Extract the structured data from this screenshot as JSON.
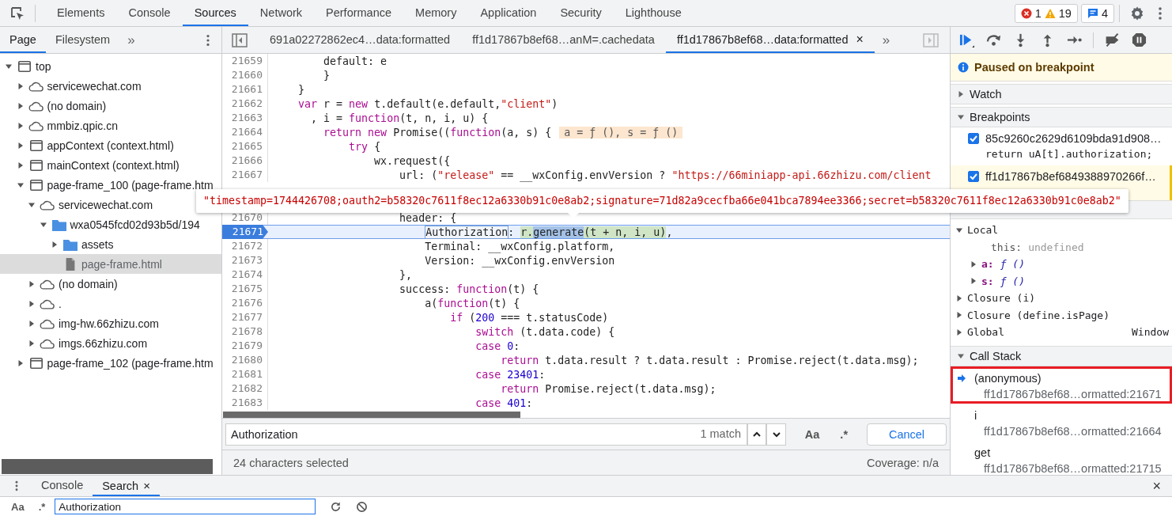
{
  "tabs": [
    {
      "label": "Elements",
      "selected": false
    },
    {
      "label": "Console",
      "selected": false
    },
    {
      "label": "Sources",
      "selected": true
    },
    {
      "label": "Network",
      "selected": false
    },
    {
      "label": "Performance",
      "selected": false
    },
    {
      "label": "Memory",
      "selected": false
    },
    {
      "label": "Application",
      "selected": false
    },
    {
      "label": "Security",
      "selected": false
    },
    {
      "label": "Lighthouse",
      "selected": false
    }
  ],
  "issues": {
    "errors": "1",
    "warnings": "19",
    "messages": "4"
  },
  "navigator": {
    "tabs": [
      {
        "label": "Page",
        "selected": true
      },
      {
        "label": "Filesystem",
        "selected": false
      }
    ],
    "more": "»",
    "tree": [
      {
        "label": "top",
        "kind": "frame",
        "expanded": true,
        "selected": false,
        "children": [
          {
            "label": "servicewechat.com",
            "kind": "domain",
            "expanded": false,
            "selected": false
          },
          {
            "label": "(no domain)",
            "kind": "domain",
            "expanded": false,
            "selected": false
          },
          {
            "label": "mmbiz.qpic.cn",
            "kind": "domain",
            "expanded": false,
            "selected": false
          },
          {
            "label": "appContext (context.html)",
            "kind": "frame",
            "expanded": false,
            "selected": false
          },
          {
            "label": "mainContext (context.html)",
            "kind": "frame",
            "expanded": false,
            "selected": false
          },
          {
            "label": "page-frame_100 (page-frame.htm",
            "kind": "frame",
            "expanded": true,
            "selected": false,
            "children": [
              {
                "label": "servicewechat.com",
                "kind": "domain",
                "expanded": true,
                "selected": false,
                "children": [
                  {
                    "label": "wxa0545fcd02d93b5d/194",
                    "kind": "folder",
                    "expanded": true,
                    "selected": false,
                    "children": [
                      {
                        "label": "assets",
                        "kind": "folder",
                        "expanded": false,
                        "selected": false
                      },
                      {
                        "label": "page-frame.html",
                        "kind": "file",
                        "selected": true
                      }
                    ]
                  }
                ]
              },
              {
                "label": "(no domain)",
                "kind": "domain",
                "expanded": false,
                "selected": false
              },
              {
                "label": ".",
                "kind": "domain",
                "expanded": false,
                "selected": false
              },
              {
                "label": "img-hw.66zhizu.com",
                "kind": "domain",
                "expanded": false,
                "selected": false
              },
              {
                "label": "imgs.66zhizu.com",
                "kind": "domain",
                "expanded": false,
                "selected": false
              }
            ]
          },
          {
            "label": "page-frame_102 (page-frame.htm",
            "kind": "frame",
            "expanded": false,
            "selected": false
          }
        ]
      }
    ]
  },
  "editor": {
    "tabs": [
      {
        "label": "691a02272862ec4…data:formatted",
        "selected": false
      },
      {
        "label": "ff1d17867b8ef68…anM=.cachedata",
        "selected": false
      },
      {
        "label": "ff1d17867b8ef68…data:formatted",
        "selected": true,
        "close": "×"
      }
    ],
    "more": "»",
    "lines": [
      {
        "kind": "code",
        "number": "21659",
        "paused": false,
        "tokens": [
          {
            "text": "        default: e",
            "kind": "plain"
          }
        ]
      },
      {
        "kind": "code",
        "number": "21660",
        "paused": false,
        "tokens": [
          {
            "text": "        }",
            "kind": "plain"
          }
        ]
      },
      {
        "kind": "code",
        "number": "21661",
        "paused": false,
        "tokens": [
          {
            "text": "    }",
            "kind": "plain"
          }
        ]
      },
      {
        "kind": "code",
        "number": "21662",
        "paused": false,
        "tokens": [
          {
            "text": "    var",
            "kind": "keyword"
          },
          {
            "text": " r = ",
            "kind": "plain"
          },
          {
            "text": "new",
            "kind": "keyword"
          },
          {
            "text": " t.default(e.default,",
            "kind": "plain"
          },
          {
            "text": "\"client\"",
            "kind": "string"
          },
          {
            "text": ")",
            "kind": "plain"
          }
        ]
      },
      {
        "kind": "code",
        "number": "21663",
        "paused": false,
        "tokens": [
          {
            "text": "      , i = ",
            "kind": "plain"
          },
          {
            "text": "function",
            "kind": "keyword"
          },
          {
            "text": "(t, n, i, u) {",
            "kind": "plain"
          }
        ]
      },
      {
        "kind": "code",
        "number": "21664",
        "paused": false,
        "tokens": [
          {
            "text": "        return new",
            "kind": "keyword"
          },
          {
            "text": " Promise((",
            "kind": "plain"
          },
          {
            "text": "function",
            "kind": "keyword"
          },
          {
            "text": "(a, s) {",
            "kind": "plain"
          }
        ],
        "inline": "a = ƒ (), s = ƒ ()"
      },
      {
        "kind": "code",
        "number": "21665",
        "paused": false,
        "tokens": [
          {
            "text": "            try",
            "kind": "keyword"
          },
          {
            "text": " {",
            "kind": "plain"
          }
        ]
      },
      {
        "kind": "code",
        "number": "21666",
        "paused": false,
        "tokens": [
          {
            "text": "                wx.request({",
            "kind": "plain"
          }
        ]
      },
      {
        "kind": "code",
        "number": "21667",
        "paused": false,
        "tokens": [
          {
            "text": "                    url: (",
            "kind": "plain"
          },
          {
            "text": "\"release\"",
            "kind": "string"
          },
          {
            "text": " == __wxConfig.envVersion ? ",
            "kind": "plain"
          },
          {
            "text": "\"https://66miniapp-api.66zhizu.com/client",
            "kind": "string"
          }
        ]
      },
      {
        "kind": "popover",
        "text": "\"timestamp=1744426708;oauth2=b58320c7611f8ec12a6330b91c0e8ab2;signature=71d82a9cecfba66e041bca7894ee3366;secret=b58320c7611f8ec12a6330b91c0e8ab2\""
      },
      {
        "kind": "code",
        "number": "21670",
        "paused": false,
        "tokens": [
          {
            "text": "                    header: {",
            "kind": "plain"
          }
        ]
      },
      {
        "kind": "code",
        "number": "21671",
        "paused": true,
        "tokens": [
          {
            "text": "                        Authorization",
            "kind": "match"
          },
          {
            "text": ": ",
            "kind": "plain"
          },
          {
            "text": "r.",
            "kind": "selection"
          },
          {
            "text": "generate",
            "kind": "word"
          },
          {
            "text": "(t + n, i, u)",
            "kind": "selection"
          },
          {
            "text": ",",
            "kind": "plain"
          }
        ]
      },
      {
        "kind": "code",
        "number": "21672",
        "paused": false,
        "tokens": [
          {
            "text": "                        Terminal: __wxConfig.platform,",
            "kind": "plain"
          }
        ]
      },
      {
        "kind": "code",
        "number": "21673",
        "paused": false,
        "tokens": [
          {
            "text": "                        Version: __wxConfig.envVersion",
            "kind": "plain"
          }
        ]
      },
      {
        "kind": "code",
        "number": "21674",
        "paused": false,
        "tokens": [
          {
            "text": "                    },",
            "kind": "plain"
          }
        ]
      },
      {
        "kind": "code",
        "number": "21675",
        "paused": false,
        "tokens": [
          {
            "text": "                    success: ",
            "kind": "plain"
          },
          {
            "text": "function",
            "kind": "keyword"
          },
          {
            "text": "(t) {",
            "kind": "plain"
          }
        ]
      },
      {
        "kind": "code",
        "number": "21676",
        "paused": false,
        "tokens": [
          {
            "text": "                        a(",
            "kind": "plain"
          },
          {
            "text": "function",
            "kind": "keyword"
          },
          {
            "text": "(t) {",
            "kind": "plain"
          }
        ]
      },
      {
        "kind": "code",
        "number": "21677",
        "paused": false,
        "tokens": [
          {
            "text": "                            if",
            "kind": "keyword"
          },
          {
            "text": " (",
            "kind": "plain"
          },
          {
            "text": "200",
            "kind": "number"
          },
          {
            "text": " === t.statusCode)",
            "kind": "plain"
          }
        ]
      },
      {
        "kind": "code",
        "number": "21678",
        "paused": false,
        "tokens": [
          {
            "text": "                                switch",
            "kind": "keyword"
          },
          {
            "text": " (t.data.code) {",
            "kind": "plain"
          }
        ]
      },
      {
        "kind": "code",
        "number": "21679",
        "paused": false,
        "tokens": [
          {
            "text": "                                case",
            "kind": "keyword"
          },
          {
            "text": " 0",
            "kind": "number"
          },
          {
            "text": ":",
            "kind": "plain"
          }
        ]
      },
      {
        "kind": "code",
        "number": "21680",
        "paused": false,
        "tokens": [
          {
            "text": "                                    return",
            "kind": "keyword"
          },
          {
            "text": " t.data.result ? t.data.result : Promise.reject(t.data.msg);",
            "kind": "plain"
          }
        ]
      },
      {
        "kind": "code",
        "number": "21681",
        "paused": false,
        "tokens": [
          {
            "text": "                                case",
            "kind": "keyword"
          },
          {
            "text": " 23401",
            "kind": "number"
          },
          {
            "text": ":",
            "kind": "plain"
          }
        ]
      },
      {
        "kind": "code",
        "number": "21682",
        "paused": false,
        "tokens": [
          {
            "text": "                                    return",
            "kind": "keyword"
          },
          {
            "text": " Promise.reject(t.data.msg);",
            "kind": "plain"
          }
        ]
      },
      {
        "kind": "code",
        "number": "21683",
        "paused": false,
        "tokens": [
          {
            "text": "                                case",
            "kind": "keyword"
          },
          {
            "text": " 401",
            "kind": "number"
          },
          {
            "text": ":",
            "kind": "plain"
          }
        ]
      }
    ],
    "find": {
      "query": "Authorization",
      "matches": "1 match",
      "case_toggle": "Aa",
      "regex_toggle": ".*",
      "cancel": "Cancel"
    },
    "status": {
      "selection": "24 characters selected",
      "coverage": "Coverage: n/a"
    }
  },
  "debugger": {
    "banner": "Paused on breakpoint",
    "watch": {
      "title": "Watch",
      "expanded": false
    },
    "breakpoints": {
      "title": "Breakpoints",
      "expanded": true,
      "items": [
        {
          "file": "85c9260c2629d6109bda91d908…",
          "code": "return uA[t].authorization;",
          "checked": true,
          "selected": false
        },
        {
          "file": "ff1d17867b8ef6849388970266f…",
          "checked": true,
          "selected": true
        }
      ]
    },
    "scope": {
      "items": [
        {
          "label": "Local",
          "expanded": true,
          "children": [
            {
              "name": "this:",
              "value": "undefined",
              "kind": "primitive"
            },
            {
              "name": "a:",
              "value": "ƒ ()",
              "kind": "function",
              "expanded": false
            },
            {
              "name": "s:",
              "value": "ƒ ()",
              "kind": "function",
              "expanded": false
            }
          ]
        },
        {
          "label": "Closure (i)",
          "expanded": false
        },
        {
          "label": "Closure (define.isPage)",
          "expanded": false
        },
        {
          "label": "Global",
          "value": "Window",
          "expanded": false
        }
      ]
    },
    "call_stack": {
      "title": "Call Stack",
      "expanded": true,
      "frames": [
        {
          "name": "(anonymous)",
          "location": "ff1d17867b8ef68…ormatted:21671",
          "selected": true,
          "outlined": true
        },
        {
          "name": "i",
          "location": "ff1d17867b8ef68…ormatted:21664",
          "selected": false,
          "outlined": false
        },
        {
          "name": "get",
          "location": "ff1d17867b8ef68…ormatted:21715",
          "selected": false,
          "outlined": false
        }
      ]
    }
  },
  "drawer": {
    "tabs": [
      {
        "label": "Console",
        "selected": false
      },
      {
        "label": "Search",
        "selected": true,
        "close": "×"
      }
    ],
    "close": "×",
    "search": {
      "case_toggle": "Aa",
      "regex_toggle": ".*",
      "query": "Authorization"
    }
  }
}
